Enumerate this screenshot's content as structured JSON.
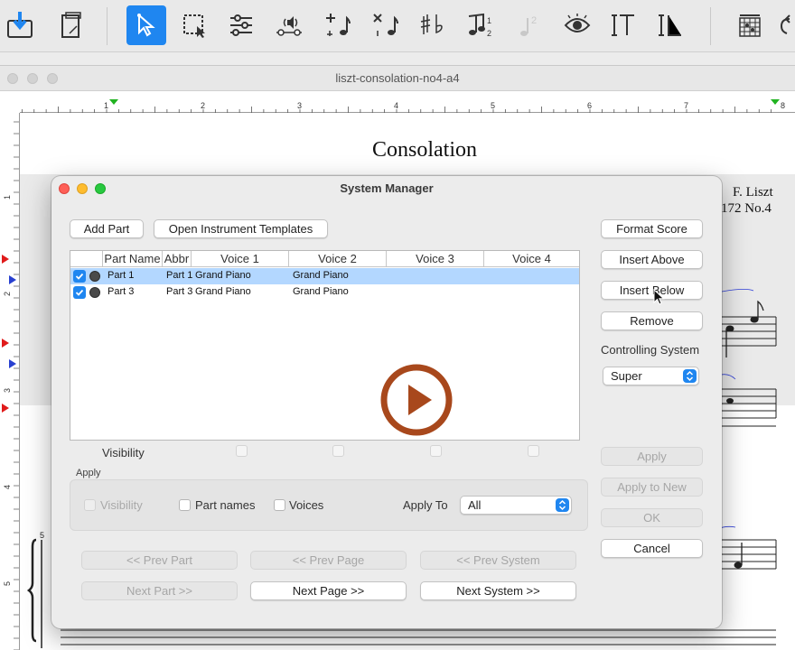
{
  "document": {
    "title": "liszt-consolation-no4-a4",
    "score_title": "Consolation",
    "composer": "F. Liszt",
    "opus": "172 No.4",
    "ruler_marks": [
      "1",
      "2",
      "3",
      "4",
      "5",
      "6",
      "7",
      "8"
    ],
    "vruler_marks": [
      "1",
      "2",
      "3",
      "4",
      "5"
    ]
  },
  "toolbar": {
    "tools": [
      "import-icon",
      "page-icon",
      "selection-arrow-icon",
      "marquee-select-icon",
      "sliders-icon",
      "audio-staff-icon",
      "add-note-icon",
      "delete-note-icon",
      "accidentals-icon",
      "tuplet-icon",
      "fingering-icon",
      "eye-icon",
      "text-icon",
      "lyrics-icon",
      "chord-grid-icon",
      "undo-icon"
    ]
  },
  "dialog": {
    "title": "System Manager",
    "add_part": "Add Part",
    "open_templates": "Open Instrument Templates",
    "columns": [
      "Part Name",
      "Abbr",
      "Voice 1",
      "Voice 2",
      "Voice 3",
      "Voice 4"
    ],
    "rows": [
      {
        "name": "Part 1",
        "abbr": "Part 1",
        "voice1": "Grand Piano",
        "voice2": "Grand Piano",
        "selected": true
      },
      {
        "name": "Part 3",
        "abbr": "Part 3",
        "voice1": "Grand Piano",
        "voice2": "Grand Piano",
        "selected": false
      }
    ],
    "visibility_label": "Visibility",
    "apply_group_label": "Apply",
    "apply_visibility": "Visibility",
    "apply_part_names": "Part names",
    "apply_voices": "Voices",
    "apply_to_label": "Apply To",
    "apply_to_value": "All",
    "side_buttons": {
      "format_score": "Format Score",
      "insert_above": "Insert Above",
      "insert_below": "Insert Below",
      "remove": "Remove",
      "controlling_label": "Controlling System",
      "controlling_value": "Super",
      "apply": "Apply",
      "apply_to_new": "Apply to New",
      "ok": "OK",
      "cancel": "Cancel"
    },
    "nav": {
      "prev_part": "<< Prev Part",
      "prev_page": "<< Prev Page",
      "prev_system": "<< Prev System",
      "next_part": "Next Part >>",
      "next_page": "Next Page >>",
      "next_system": "Next System >>"
    }
  },
  "colors": {
    "accent": "#1f86f0",
    "selection": "#b3d7ff",
    "play_button": "#a8481c"
  }
}
